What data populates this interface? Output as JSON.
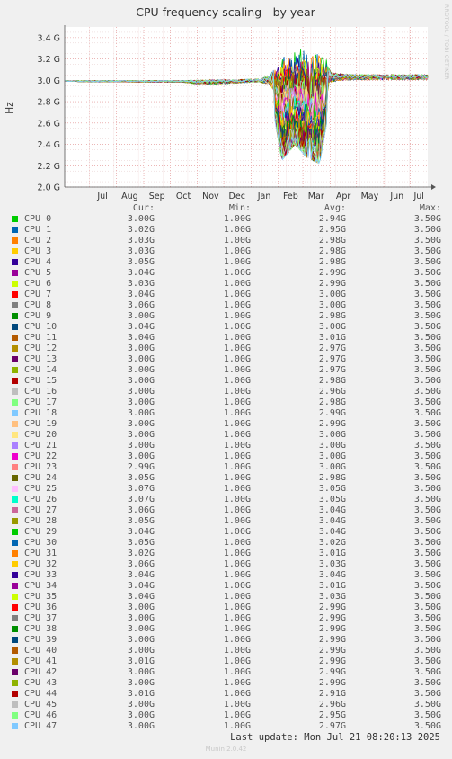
{
  "side_label": "RRDTOOL / TOBI OETIKER",
  "chart_data": {
    "type": "line",
    "title": "CPU frequency scaling - by year",
    "ylabel": "Hz",
    "xlabel": "",
    "ylim": [
      2.0,
      3.5
    ],
    "y_ticks": [
      {
        "value": 2.0,
        "label": "2.0 G"
      },
      {
        "value": 2.2,
        "label": "2.2 G"
      },
      {
        "value": 2.4,
        "label": "2.4 G"
      },
      {
        "value": 2.6,
        "label": "2.6 G"
      },
      {
        "value": 2.8,
        "label": "2.8 G"
      },
      {
        "value": 3.0,
        "label": "3.0 G"
      },
      {
        "value": 3.2,
        "label": "3.2 G"
      },
      {
        "value": 3.4,
        "label": "3.4 G"
      }
    ],
    "x_range": [
      "2024-06-03",
      "2025-07-21"
    ],
    "x_ticks": [
      {
        "date": "2024-07-01",
        "label": "Jul"
      },
      {
        "date": "2024-08-01",
        "label": "Aug"
      },
      {
        "date": "2024-09-01",
        "label": "Sep"
      },
      {
        "date": "2024-10-01",
        "label": "Oct"
      },
      {
        "date": "2024-11-01",
        "label": "Nov"
      },
      {
        "date": "2024-12-01",
        "label": "Dec"
      },
      {
        "date": "2025-01-01",
        "label": "Jan"
      },
      {
        "date": "2025-02-01",
        "label": "Feb"
      },
      {
        "date": "2025-03-01",
        "label": "Mar"
      },
      {
        "date": "2025-04-01",
        "label": "Apr"
      },
      {
        "date": "2025-05-01",
        "label": "May"
      },
      {
        "date": "2025-06-01",
        "label": "Jun"
      },
      {
        "date": "2025-07-01",
        "label": "Jul"
      }
    ],
    "grid": true,
    "shape": {
      "dates": [
        "2024-06-03",
        "2024-10-15",
        "2024-11-05",
        "2024-12-15",
        "2025-01-10",
        "2025-01-22",
        "2025-02-05",
        "2025-02-20",
        "2025-03-05",
        "2025-03-20",
        "2025-03-28",
        "2025-04-02",
        "2025-04-10",
        "2025-05-01",
        "2025-06-01",
        "2025-07-21"
      ],
      "base": [
        2.99,
        2.99,
        2.98,
        2.99,
        3.0,
        3.0,
        3.01,
        3.01,
        3.02,
        3.02,
        3.01,
        3.03,
        3.03,
        3.03,
        3.03,
        3.03
      ],
      "spread": [
        0.01,
        0.01,
        0.03,
        0.02,
        0.02,
        0.05,
        0.28,
        0.36,
        0.42,
        0.4,
        0.18,
        0.06,
        0.04,
        0.03,
        0.03,
        0.03
      ],
      "drop_min": [
        2.99,
        2.98,
        2.95,
        2.97,
        2.98,
        2.92,
        2.25,
        2.4,
        2.28,
        2.22,
        2.6,
        2.95,
        2.98,
        2.99,
        2.99,
        2.99
      ],
      "peak_max": [
        3.0,
        3.0,
        3.01,
        3.01,
        3.02,
        3.05,
        3.24,
        3.28,
        3.3,
        3.28,
        3.2,
        3.1,
        3.07,
        3.06,
        3.06,
        3.06
      ]
    }
  },
  "legend": {
    "headers": {
      "cur": "Cur:",
      "min": "Min:",
      "avg": "Avg:",
      "max": "Max:"
    },
    "rows": [
      {
        "name": "CPU 0",
        "color": "#00cc00",
        "cur": "3.00G",
        "min": "1.00G",
        "avg": "2.94G",
        "max": "3.50G"
      },
      {
        "name": "CPU 1",
        "color": "#0066b3",
        "cur": "3.02G",
        "min": "1.00G",
        "avg": "2.95G",
        "max": "3.50G"
      },
      {
        "name": "CPU 2",
        "color": "#ff8000",
        "cur": "3.03G",
        "min": "1.00G",
        "avg": "2.98G",
        "max": "3.50G"
      },
      {
        "name": "CPU 3",
        "color": "#ffcc00",
        "cur": "3.03G",
        "min": "1.00G",
        "avg": "2.98G",
        "max": "3.50G"
      },
      {
        "name": "CPU 4",
        "color": "#330099",
        "cur": "3.05G",
        "min": "1.00G",
        "avg": "2.98G",
        "max": "3.50G"
      },
      {
        "name": "CPU 5",
        "color": "#990099",
        "cur": "3.04G",
        "min": "1.00G",
        "avg": "2.99G",
        "max": "3.50G"
      },
      {
        "name": "CPU 6",
        "color": "#ccff00",
        "cur": "3.03G",
        "min": "1.00G",
        "avg": "2.99G",
        "max": "3.50G"
      },
      {
        "name": "CPU 7",
        "color": "#ff0000",
        "cur": "3.04G",
        "min": "1.00G",
        "avg": "3.00G",
        "max": "3.50G"
      },
      {
        "name": "CPU 8",
        "color": "#808080",
        "cur": "3.06G",
        "min": "1.00G",
        "avg": "3.00G",
        "max": "3.50G"
      },
      {
        "name": "CPU 9",
        "color": "#008f00",
        "cur": "3.00G",
        "min": "1.00G",
        "avg": "2.98G",
        "max": "3.50G"
      },
      {
        "name": "CPU 10",
        "color": "#00487d",
        "cur": "3.04G",
        "min": "1.00G",
        "avg": "3.00G",
        "max": "3.50G"
      },
      {
        "name": "CPU 11",
        "color": "#b35a00",
        "cur": "3.04G",
        "min": "1.00G",
        "avg": "3.01G",
        "max": "3.50G"
      },
      {
        "name": "CPU 12",
        "color": "#b38f00",
        "cur": "3.00G",
        "min": "1.00G",
        "avg": "2.97G",
        "max": "3.50G"
      },
      {
        "name": "CPU 13",
        "color": "#6b006b",
        "cur": "3.00G",
        "min": "1.00G",
        "avg": "2.97G",
        "max": "3.50G"
      },
      {
        "name": "CPU 14",
        "color": "#8fb300",
        "cur": "3.00G",
        "min": "1.00G",
        "avg": "2.97G",
        "max": "3.50G"
      },
      {
        "name": "CPU 15",
        "color": "#b30000",
        "cur": "3.00G",
        "min": "1.00G",
        "avg": "2.98G",
        "max": "3.50G"
      },
      {
        "name": "CPU 16",
        "color": "#bebebe",
        "cur": "3.00G",
        "min": "1.00G",
        "avg": "2.96G",
        "max": "3.50G"
      },
      {
        "name": "CPU 17",
        "color": "#80ff80",
        "cur": "3.00G",
        "min": "1.00G",
        "avg": "2.98G",
        "max": "3.50G"
      },
      {
        "name": "CPU 18",
        "color": "#80c9ff",
        "cur": "3.00G",
        "min": "1.00G",
        "avg": "2.99G",
        "max": "3.50G"
      },
      {
        "name": "CPU 19",
        "color": "#ffc080",
        "cur": "3.00G",
        "min": "1.00G",
        "avg": "2.99G",
        "max": "3.50G"
      },
      {
        "name": "CPU 20",
        "color": "#ffe680",
        "cur": "3.00G",
        "min": "1.00G",
        "avg": "3.00G",
        "max": "3.50G"
      },
      {
        "name": "CPU 21",
        "color": "#aa80ff",
        "cur": "3.00G",
        "min": "1.00G",
        "avg": "3.00G",
        "max": "3.50G"
      },
      {
        "name": "CPU 22",
        "color": "#ee00cc",
        "cur": "3.00G",
        "min": "1.00G",
        "avg": "3.00G",
        "max": "3.50G"
      },
      {
        "name": "CPU 23",
        "color": "#ff8080",
        "cur": "2.99G",
        "min": "1.00G",
        "avg": "3.00G",
        "max": "3.50G"
      },
      {
        "name": "CPU 24",
        "color": "#666600",
        "cur": "3.05G",
        "min": "1.00G",
        "avg": "2.98G",
        "max": "3.50G"
      },
      {
        "name": "CPU 25",
        "color": "#ffbfff",
        "cur": "3.07G",
        "min": "1.00G",
        "avg": "3.05G",
        "max": "3.50G"
      },
      {
        "name": "CPU 26",
        "color": "#00ffcc",
        "cur": "3.07G",
        "min": "1.00G",
        "avg": "3.05G",
        "max": "3.50G"
      },
      {
        "name": "CPU 27",
        "color": "#cc6699",
        "cur": "3.06G",
        "min": "1.00G",
        "avg": "3.04G",
        "max": "3.50G"
      },
      {
        "name": "CPU 28",
        "color": "#999900",
        "cur": "3.05G",
        "min": "1.00G",
        "avg": "3.04G",
        "max": "3.50G"
      },
      {
        "name": "CPU 29",
        "color": "#00cc00",
        "cur": "3.04G",
        "min": "1.00G",
        "avg": "3.04G",
        "max": "3.50G"
      },
      {
        "name": "CPU 30",
        "color": "#0066b3",
        "cur": "3.05G",
        "min": "1.00G",
        "avg": "3.02G",
        "max": "3.50G"
      },
      {
        "name": "CPU 31",
        "color": "#ff8000",
        "cur": "3.02G",
        "min": "1.00G",
        "avg": "3.01G",
        "max": "3.50G"
      },
      {
        "name": "CPU 32",
        "color": "#ffcc00",
        "cur": "3.06G",
        "min": "1.00G",
        "avg": "3.03G",
        "max": "3.50G"
      },
      {
        "name": "CPU 33",
        "color": "#330099",
        "cur": "3.04G",
        "min": "1.00G",
        "avg": "3.04G",
        "max": "3.50G"
      },
      {
        "name": "CPU 34",
        "color": "#990099",
        "cur": "3.04G",
        "min": "1.00G",
        "avg": "3.01G",
        "max": "3.50G"
      },
      {
        "name": "CPU 35",
        "color": "#ccff00",
        "cur": "3.04G",
        "min": "1.00G",
        "avg": "3.03G",
        "max": "3.50G"
      },
      {
        "name": "CPU 36",
        "color": "#ff0000",
        "cur": "3.00G",
        "min": "1.00G",
        "avg": "2.99G",
        "max": "3.50G"
      },
      {
        "name": "CPU 37",
        "color": "#808080",
        "cur": "3.00G",
        "min": "1.00G",
        "avg": "2.99G",
        "max": "3.50G"
      },
      {
        "name": "CPU 38",
        "color": "#008f00",
        "cur": "3.00G",
        "min": "1.00G",
        "avg": "2.99G",
        "max": "3.50G"
      },
      {
        "name": "CPU 39",
        "color": "#00487d",
        "cur": "3.00G",
        "min": "1.00G",
        "avg": "2.99G",
        "max": "3.50G"
      },
      {
        "name": "CPU 40",
        "color": "#b35a00",
        "cur": "3.00G",
        "min": "1.00G",
        "avg": "2.99G",
        "max": "3.50G"
      },
      {
        "name": "CPU 41",
        "color": "#b38f00",
        "cur": "3.01G",
        "min": "1.00G",
        "avg": "2.99G",
        "max": "3.50G"
      },
      {
        "name": "CPU 42",
        "color": "#6b006b",
        "cur": "3.00G",
        "min": "1.00G",
        "avg": "2.99G",
        "max": "3.50G"
      },
      {
        "name": "CPU 43",
        "color": "#8fb300",
        "cur": "3.00G",
        "min": "1.00G",
        "avg": "2.99G",
        "max": "3.50G"
      },
      {
        "name": "CPU 44",
        "color": "#b30000",
        "cur": "3.01G",
        "min": "1.00G",
        "avg": "2.91G",
        "max": "3.50G"
      },
      {
        "name": "CPU 45",
        "color": "#bebebe",
        "cur": "3.00G",
        "min": "1.00G",
        "avg": "2.96G",
        "max": "3.50G"
      },
      {
        "name": "CPU 46",
        "color": "#80ff80",
        "cur": "3.00G",
        "min": "1.00G",
        "avg": "2.95G",
        "max": "3.50G"
      },
      {
        "name": "CPU 47",
        "color": "#80c9ff",
        "cur": "3.00G",
        "min": "1.00G",
        "avg": "2.97G",
        "max": "3.50G"
      }
    ]
  },
  "footer": {
    "last_update": "Last update: Mon Jul 21 08:20:13 2025",
    "version": "Munin 2.0.42"
  }
}
